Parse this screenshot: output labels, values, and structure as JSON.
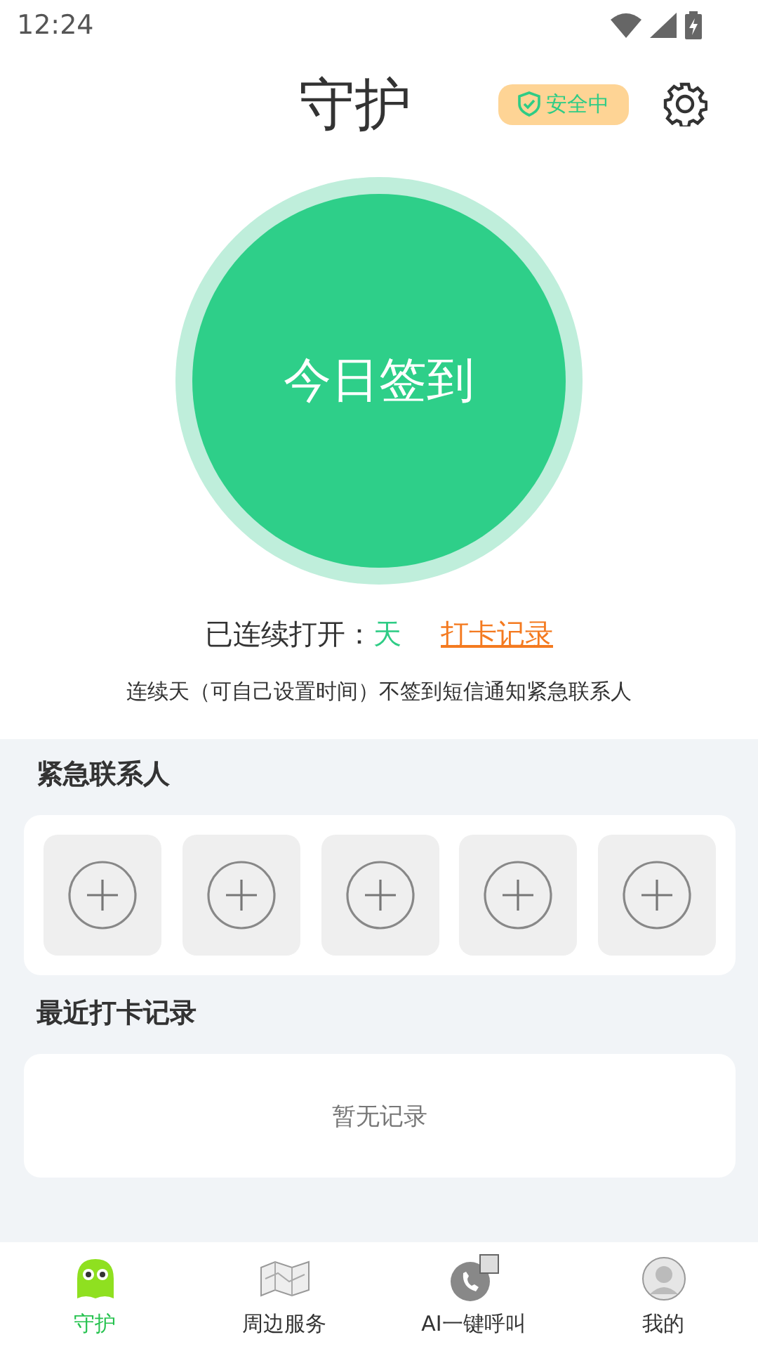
{
  "status_bar": {
    "time": "12:24"
  },
  "header": {
    "title": "守护",
    "badge": "安全中"
  },
  "checkin": {
    "button": "今日签到",
    "streak_label": "已连续打开：",
    "streak_value": "天",
    "records_link": "打卡记录",
    "note": "连续天（可自己设置时间）不签到短信通知紧急联系人"
  },
  "contacts": {
    "title": "紧急联系人",
    "slots": [
      {
        "kind": "empty"
      },
      {
        "kind": "empty"
      },
      {
        "kind": "empty"
      },
      {
        "kind": "empty"
      },
      {
        "kind": "empty"
      }
    ]
  },
  "records": {
    "title": "最近打卡记录",
    "empty": "暂无记录"
  },
  "nav": [
    {
      "label": "守护",
      "selected": true,
      "kind": "guard"
    },
    {
      "label": "周边服务",
      "selected": false,
      "kind": "map"
    },
    {
      "label": "AI一键呼叫",
      "selected": false,
      "kind": "call"
    },
    {
      "label": "我的",
      "selected": false,
      "kind": "profile"
    }
  ]
}
